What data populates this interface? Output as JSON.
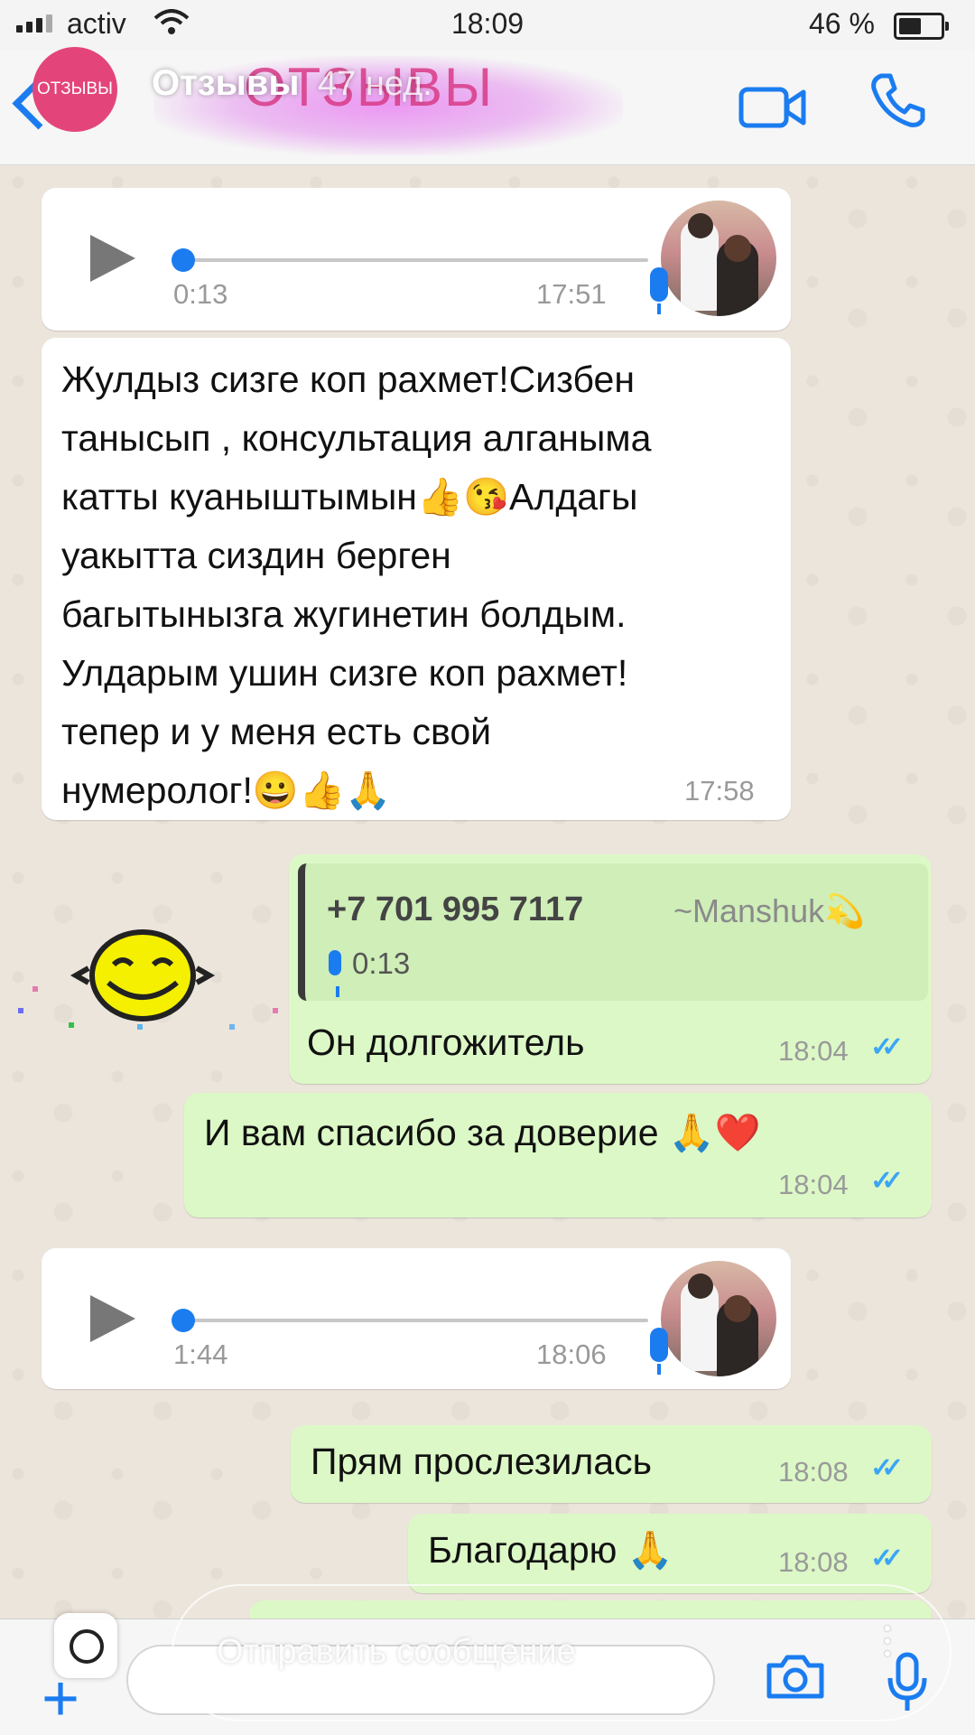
{
  "status_bar": {
    "carrier": "activ",
    "time": "18:09",
    "battery": "46 %"
  },
  "header": {
    "story_badge": "ОТЗЫВЫ",
    "story_title": "Отзывы",
    "story_age": "47 нед.",
    "contact_name_blurred": "ОТЗЫВЫ"
  },
  "messages": [
    {
      "type": "voice",
      "direction": "in",
      "duration": "0:13",
      "time": "17:51"
    },
    {
      "type": "text",
      "direction": "in",
      "lines": [
        "Жулдыз сизге коп рахмет!Сизбен",
        "танысып , консультация алганыма",
        "катты куаныштымын👍😘Алдагы",
        "уакытта сиздин берген",
        "багытынызга жугинетин болдым.",
        "Улдарым ушин сизге коп рахмет!",
        "тепер и у меня есть свой",
        "нумеролог!😀👍🙏"
      ],
      "time": "17:58"
    },
    {
      "type": "reply",
      "direction": "out",
      "quote_phone": "+7 701 995 7117",
      "quote_name": "~Manshuk💫",
      "quote_duration": "0:13",
      "text": "Он долгожитель",
      "time": "18:04"
    },
    {
      "type": "text",
      "direction": "out",
      "text": "И вам спасибо за доверие 🙏❤️",
      "time": "18:04"
    },
    {
      "type": "voice",
      "direction": "in",
      "duration": "1:44",
      "time": "18:06"
    },
    {
      "type": "text",
      "direction": "out",
      "text": "Прям прослезилась",
      "time": "18:08"
    },
    {
      "type": "text",
      "direction": "out",
      "text": "Благодарю 🙏",
      "time": "18:08"
    }
  ],
  "input": {
    "placeholder": "Отправить сообщение"
  },
  "colors": {
    "accent": "#1b7cf0",
    "incoming": "#ffffff",
    "outgoing": "#dcf8c6",
    "chat_bg": "#ece5dc",
    "read_ticks": "#3ba5f6"
  }
}
